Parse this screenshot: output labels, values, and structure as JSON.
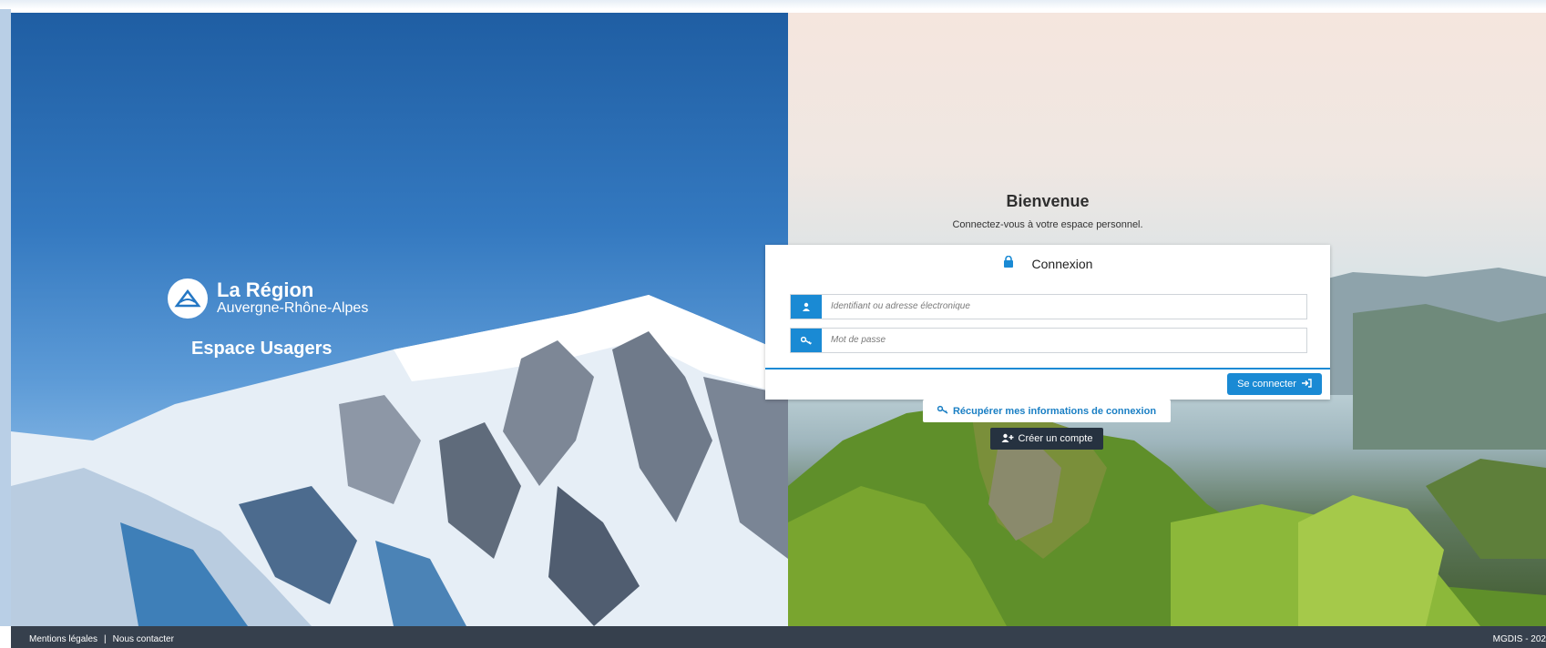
{
  "branding": {
    "region_name": "La Région",
    "region_sub": "Auvergne-Rhône-Alpes",
    "app_name": "Espace Usagers"
  },
  "welcome": {
    "title": "Bienvenue",
    "subtitle": "Connectez-vous à votre espace personnel."
  },
  "login": {
    "title": "Connexion",
    "username_placeholder": "Identifiant ou adresse électronique",
    "password_placeholder": "Mot de passe",
    "submit_label": "Se connecter",
    "recover_label": "Récupérer mes informations de connexion",
    "create_label": "Créer un compte"
  },
  "footer": {
    "legal": "Mentions légales",
    "separator": "|",
    "contact": "Nous contacter",
    "version": "MGDIS - 202"
  },
  "colors": {
    "accent": "#1a8ad4",
    "footer_bg": "#36404d",
    "dark_button": "#263240"
  },
  "icons": {
    "card_title": "lock-icon",
    "username": "user-icon",
    "password": "key-icon",
    "submit": "sign-in-icon",
    "recover": "key-icon",
    "create": "user-plus-icon"
  }
}
